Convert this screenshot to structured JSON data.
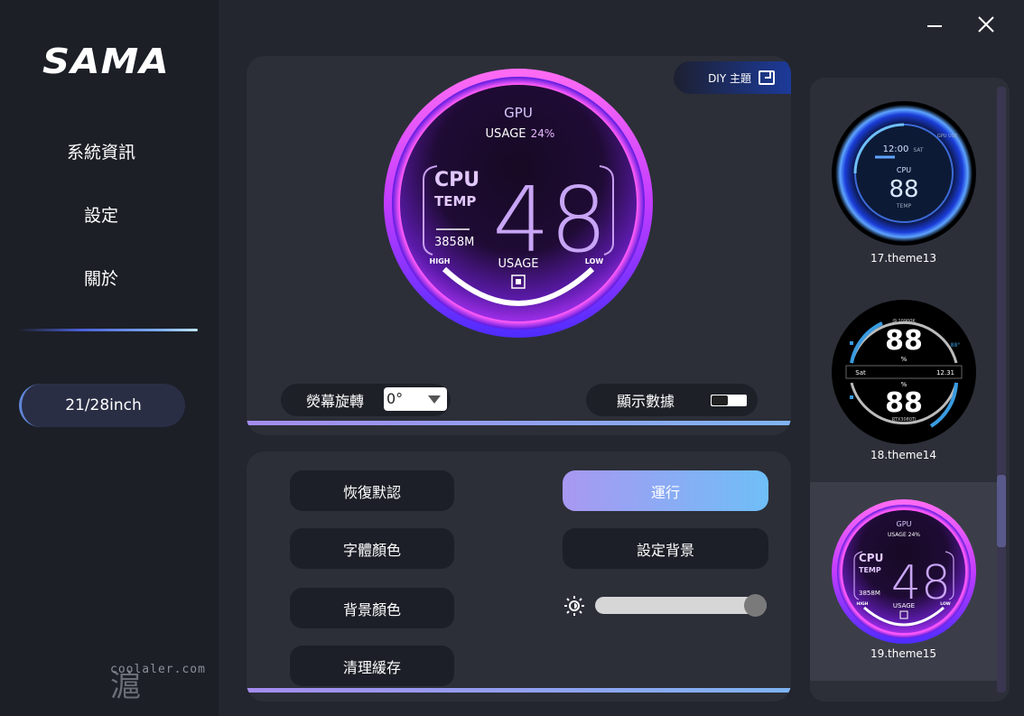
{
  "sidebar": {
    "logo": "SAMA",
    "nav": [
      "系統資訊",
      "設定",
      "關於"
    ],
    "size_label": "21/28inch",
    "watermark": "coolaler.com",
    "watermark_glyph": "滬"
  },
  "preview": {
    "diy_label": "DIY 主題",
    "dial": {
      "gpu": "GPU",
      "usage_label": "USAGE",
      "usage_value": "24%",
      "cpu": "CPU",
      "temp": "TEMP",
      "mem": "3858M",
      "value": "48",
      "usage_bottom": "USAGE",
      "high": "HIGH",
      "low": "LOW"
    },
    "rotation_label": "熒幕旋轉",
    "rotation_value": "0°",
    "display_label": "顯示數據"
  },
  "controls": {
    "restore_default": "恢復默認",
    "font_color": "字體顏色",
    "bg_color": "背景顏色",
    "clear_cache": "清理緩存",
    "run": "運行",
    "set_background": "設定背景",
    "brightness": 1.0
  },
  "themes": [
    {
      "name": "17.theme13",
      "time": "12:00",
      "day": "SAT",
      "corner": "GPU USE",
      "label": "CPU",
      "value": "88",
      "sub": "TEMP"
    },
    {
      "name": "18.theme14",
      "top_small": "i9 10900K",
      "value1": "88",
      "unit1": "%",
      "side_right": "88°",
      "left_day": "Sat",
      "right_date": "12.31",
      "value2": "88",
      "unit2": "%",
      "bottom_small": "RTX3080Ti"
    },
    {
      "name": "19.theme15",
      "selected": true,
      "gpu": "GPU",
      "usage": "USAGE 24%",
      "cpu": "CPU",
      "temp": "TEMP",
      "mem": "3858M",
      "value": "48",
      "usage_bottom": "USAGE",
      "high": "HIGH",
      "low": "LOW"
    }
  ],
  "colors": {
    "accent_purple": "#a58cf0",
    "accent_blue": "#7fb4f3",
    "panel": "#2c2f38",
    "sidebar": "#1c1f26"
  }
}
